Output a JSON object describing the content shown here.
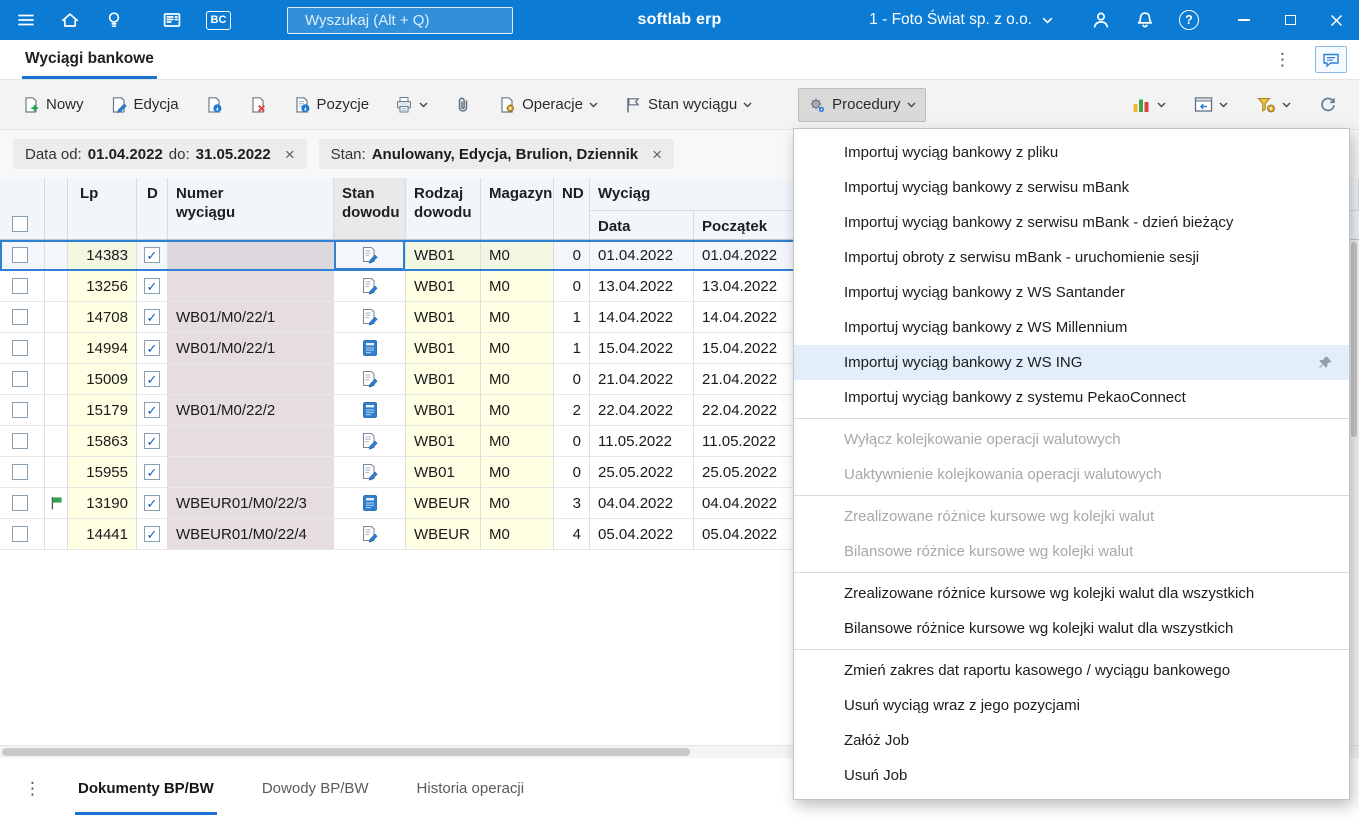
{
  "topbar": {
    "app_name": "softlab erp",
    "search_placeholder": "Wyszukaj (Alt + Q)",
    "company": "1 - Foto Świat sp. z o.o."
  },
  "glyphs": {
    "bc": "BC",
    "help": "?",
    "more_vertical": "⋮",
    "chip_close": "×",
    "check": "✓"
  },
  "icons": {
    "topbar": [
      "hamburger",
      "home",
      "lightbulb",
      "news-document",
      "bc-badge",
      "magnifier",
      "person",
      "bell",
      "question-circle",
      "minimize",
      "maximize",
      "close"
    ],
    "toolbar": [
      "new-document-plus",
      "edit-pencil",
      "document-info",
      "document-delete",
      "document-positions",
      "printer",
      "paperclip",
      "document-gear",
      "flag",
      "gears",
      "bar-chart",
      "dock-window",
      "filter-gear",
      "refresh"
    ],
    "table": [
      "checkbox",
      "green-flag",
      "document-pencil",
      "blue-journal"
    ],
    "menu": [
      "pushpin"
    ]
  },
  "tabbar": {
    "active_tab": "Wyciągi bankowe"
  },
  "toolbar": {
    "nowy": "Nowy",
    "edycja": "Edycja",
    "pozycje": "Pozycje",
    "operacje": "Operacje",
    "stan_wyciagu": "Stan wyciągu",
    "procedury": "Procedury"
  },
  "filters": {
    "date_label_od": "Data od:",
    "date_od": "01.04.2022",
    "date_label_do": "do:",
    "date_do": "31.05.2022",
    "stan_label": "Stan:",
    "stan_value": "Anulowany, Edycja, Brulion, Dziennik"
  },
  "table": {
    "headers": {
      "lp": "Lp",
      "d": "D",
      "numer_line1": "Numer",
      "numer_line2": "wyciągu",
      "stan_line1": "Stan",
      "stan_line2": "dowodu",
      "rodzaj_line1": "Rodzaj",
      "rodzaj_line2": "dowodu",
      "magazyn": "Magazyn",
      "nd": "ND",
      "wyciag": "Wyciąg",
      "data": "Data",
      "poczatek": "Początek"
    },
    "rows": [
      {
        "lp": "14383",
        "checked": true,
        "numer": "",
        "rodzaj": "WB01",
        "magazyn": "M0",
        "nd": "0",
        "data": "01.04.2022",
        "poczatek": "01.04.2022",
        "selected": true
      },
      {
        "lp": "13256",
        "checked": true,
        "numer": "",
        "rodzaj": "WB01",
        "magazyn": "M0",
        "nd": "0",
        "data": "13.04.2022",
        "poczatek": "13.04.2022"
      },
      {
        "lp": "14708",
        "checked": true,
        "numer": "WB01/M0/22/1",
        "rodzaj": "WB01",
        "magazyn": "M0",
        "nd": "1",
        "data": "14.04.2022",
        "poczatek": "14.04.2022"
      },
      {
        "lp": "14994",
        "checked": true,
        "numer": "WB01/M0/22/1",
        "rodzaj": "WB01",
        "magazyn": "M0",
        "nd": "1",
        "data": "15.04.2022",
        "poczatek": "15.04.2022",
        "saved": true
      },
      {
        "lp": "15009",
        "checked": true,
        "numer": "",
        "rodzaj": "WB01",
        "magazyn": "M0",
        "nd": "0",
        "data": "21.04.2022",
        "poczatek": "21.04.2022"
      },
      {
        "lp": "15179",
        "checked": true,
        "numer": "WB01/M0/22/2",
        "rodzaj": "WB01",
        "magazyn": "M0",
        "nd": "2",
        "data": "22.04.2022",
        "poczatek": "22.04.2022",
        "saved": true
      },
      {
        "lp": "15863",
        "checked": true,
        "numer": "",
        "rodzaj": "WB01",
        "magazyn": "M0",
        "nd": "0",
        "data": "11.05.2022",
        "poczatek": "11.05.2022"
      },
      {
        "lp": "15955",
        "checked": true,
        "numer": "",
        "rodzaj": "WB01",
        "magazyn": "M0",
        "nd": "0",
        "data": "25.05.2022",
        "poczatek": "25.05.2022"
      },
      {
        "lp": "13190",
        "checked": true,
        "numer": "WBEUR01/M0/22/3",
        "rodzaj": "WBEUR",
        "magazyn": "M0",
        "nd": "3",
        "data": "04.04.2022",
        "poczatek": "04.04.2022",
        "saved": true,
        "flag": true
      },
      {
        "lp": "14441",
        "checked": true,
        "numer": "WBEUR01/M0/22/4",
        "rodzaj": "WBEUR",
        "magazyn": "M0",
        "nd": "4",
        "data": "05.04.2022",
        "poczatek": "05.04.2022"
      }
    ]
  },
  "menu": {
    "items": [
      {
        "label": "Importuj wyciąg bankowy z pliku"
      },
      {
        "label": "Importuj wyciąg bankowy z serwisu mBank"
      },
      {
        "label": "Importuj wyciąg bankowy z serwisu mBank - dzień bieżący"
      },
      {
        "label": "Importuj obroty z serwisu mBank - uruchomienie sesji"
      },
      {
        "label": "Importuj wyciąg bankowy z WS Santander"
      },
      {
        "label": "Importuj wyciąg bankowy z WS Millennium"
      },
      {
        "label": "Importuj wyciąg bankowy z WS ING",
        "highlighted": true,
        "pinned": true
      },
      {
        "label": "Importuj wyciąg bankowy z systemu PekaoConnect"
      },
      {
        "separator": true
      },
      {
        "label": "Wyłącz kolejkowanie operacji walutowych",
        "disabled": true
      },
      {
        "label": "Uaktywnienie kolejkowania operacji walutowych",
        "disabled": true
      },
      {
        "separator": true
      },
      {
        "label": "Zrealizowane różnice kursowe wg kolejki walut",
        "disabled": true
      },
      {
        "label": "Bilansowe różnice kursowe wg kolejki walut",
        "disabled": true
      },
      {
        "separator": true
      },
      {
        "label": "Zrealizowane różnice kursowe wg kolejki walut dla wszystkich"
      },
      {
        "label": "Bilansowe różnice kursowe wg kolejki walut dla wszystkich"
      },
      {
        "separator": true
      },
      {
        "label": "Zmień zakres dat raportu kasowego / wyciągu bankowego"
      },
      {
        "label": "Usuń wyciąg wraz z jego pozycjami"
      },
      {
        "label": "Załóż Job"
      },
      {
        "label": "Usuń Job"
      }
    ]
  },
  "bottombar": {
    "tabs": [
      {
        "label": "Dokumenty BP/BW",
        "active": true
      },
      {
        "label": "Dowody BP/BW"
      },
      {
        "label": "Historia operacji"
      }
    ]
  }
}
